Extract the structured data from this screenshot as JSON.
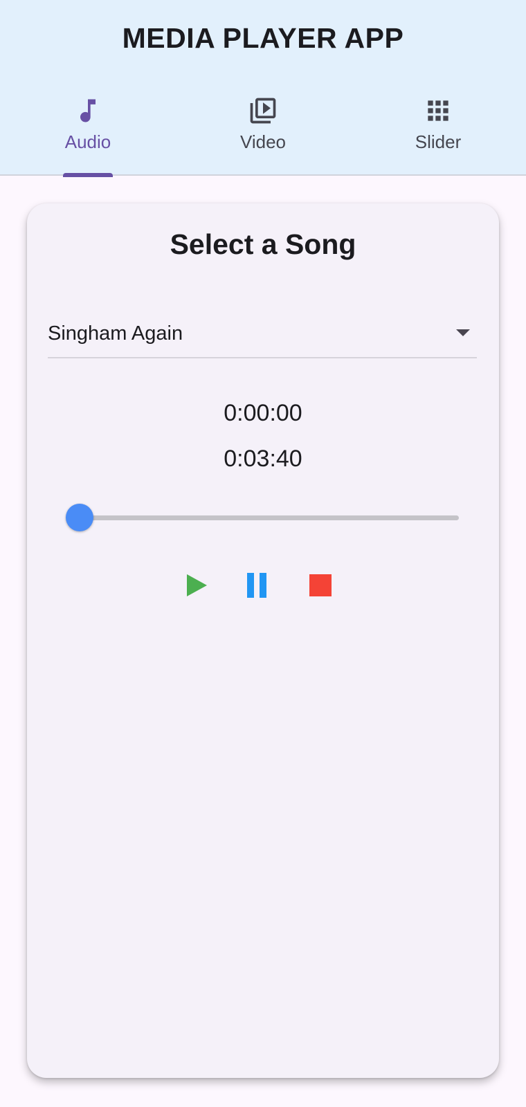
{
  "app": {
    "title": "MEDIA PLAYER APP",
    "tabs": [
      {
        "label": "Audio",
        "icon": "music-note-icon",
        "active": true
      },
      {
        "label": "Video",
        "icon": "video-library-icon",
        "active": false
      },
      {
        "label": "Slider",
        "icon": "grid-icon",
        "active": false
      }
    ]
  },
  "player": {
    "heading": "Select a Song",
    "selected_song": "Singham Again",
    "current_time": "0:00:00",
    "total_time": "0:03:40",
    "progress": 0.0,
    "controls": [
      {
        "name": "play",
        "icon": "play-icon",
        "color": "#4caf50"
      },
      {
        "name": "pause",
        "icon": "pause-icon",
        "color": "#2196f3"
      },
      {
        "name": "stop",
        "icon": "stop-icon",
        "color": "#f44336"
      }
    ]
  },
  "colors": {
    "app_bar_bg": "#e2f0fc",
    "accent": "#6750a4",
    "slider": "#4a8cf6"
  }
}
